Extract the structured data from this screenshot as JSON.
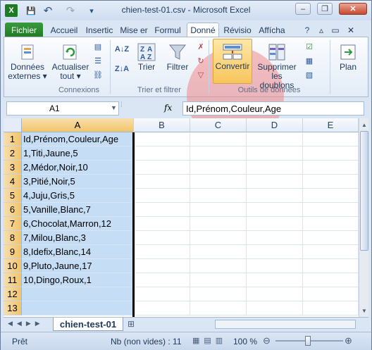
{
  "window": {
    "title": "chien-test-01.csv - Microsoft Excel"
  },
  "quick_access": {
    "app_icon": "X",
    "save_icon": "💾",
    "undo_icon": "↶",
    "redo_icon": "↷",
    "customize_icon": "▾"
  },
  "window_buttons": {
    "minimize": "–",
    "restore": "❐",
    "close": "✕"
  },
  "tabs": [
    "Fichier",
    "Accueil",
    "Insertic",
    "Mise er",
    "Formul",
    "Donné",
    "Révisio",
    "Affícha"
  ],
  "ribbon_right": {
    "help": "?",
    "minimize": "▵",
    "restore": "▭",
    "close": "✕"
  },
  "ribbon": {
    "donnees_externes": "Données externes ▾",
    "actualiser": "Actualiser tout ▾",
    "connexions_group": "Connexions",
    "trier": "Trier",
    "filtrer": "Filtrer",
    "trier_filtrer_group": "Trier et filtrer",
    "convertir": "Convertir",
    "supprimer_doublons": "Supprimer les doublons",
    "outils_group": "Outils de données",
    "plan": "Plan",
    "sort_az": "A↓Z",
    "sort_za": "Z↓A"
  },
  "formula": {
    "name_box": "A1",
    "fx": "fx",
    "content": "Id,Prénom,Couleur,Age"
  },
  "columns": [
    "A",
    "B",
    "C",
    "D",
    "E"
  ],
  "rows": [
    {
      "n": "1",
      "a": "Id,Prénom,Couleur,Age"
    },
    {
      "n": "2",
      "a": "1,Titi,Jaune,5"
    },
    {
      "n": "3",
      "a": "2,Médor,Noir,10"
    },
    {
      "n": "4",
      "a": "3,Pitié,Noir,5"
    },
    {
      "n": "5",
      "a": "4,Juju,Gris,5"
    },
    {
      "n": "6",
      "a": "5,Vanille,Blanc,7"
    },
    {
      "n": "7",
      "a": "6,Chocolat,Marron,12"
    },
    {
      "n": "8",
      "a": "7,Milou,Blanc,3"
    },
    {
      "n": "9",
      "a": "8,Idefix,Blanc,14"
    },
    {
      "n": "10",
      "a": "9,Pluto,Jaune,17"
    },
    {
      "n": "11",
      "a": "10,Dingo,Roux,1"
    },
    {
      "n": "12",
      "a": ""
    },
    {
      "n": "13",
      "a": ""
    }
  ],
  "sheet": {
    "tab": "chien-test-01"
  },
  "status": {
    "ready": "Prêt",
    "count": "Nb (non vides) : 11",
    "zoom": "100 %"
  },
  "colors": {
    "selection": "#c6ddf6",
    "highlight": "#f28080",
    "file_tab": "#2a8a2f"
  }
}
